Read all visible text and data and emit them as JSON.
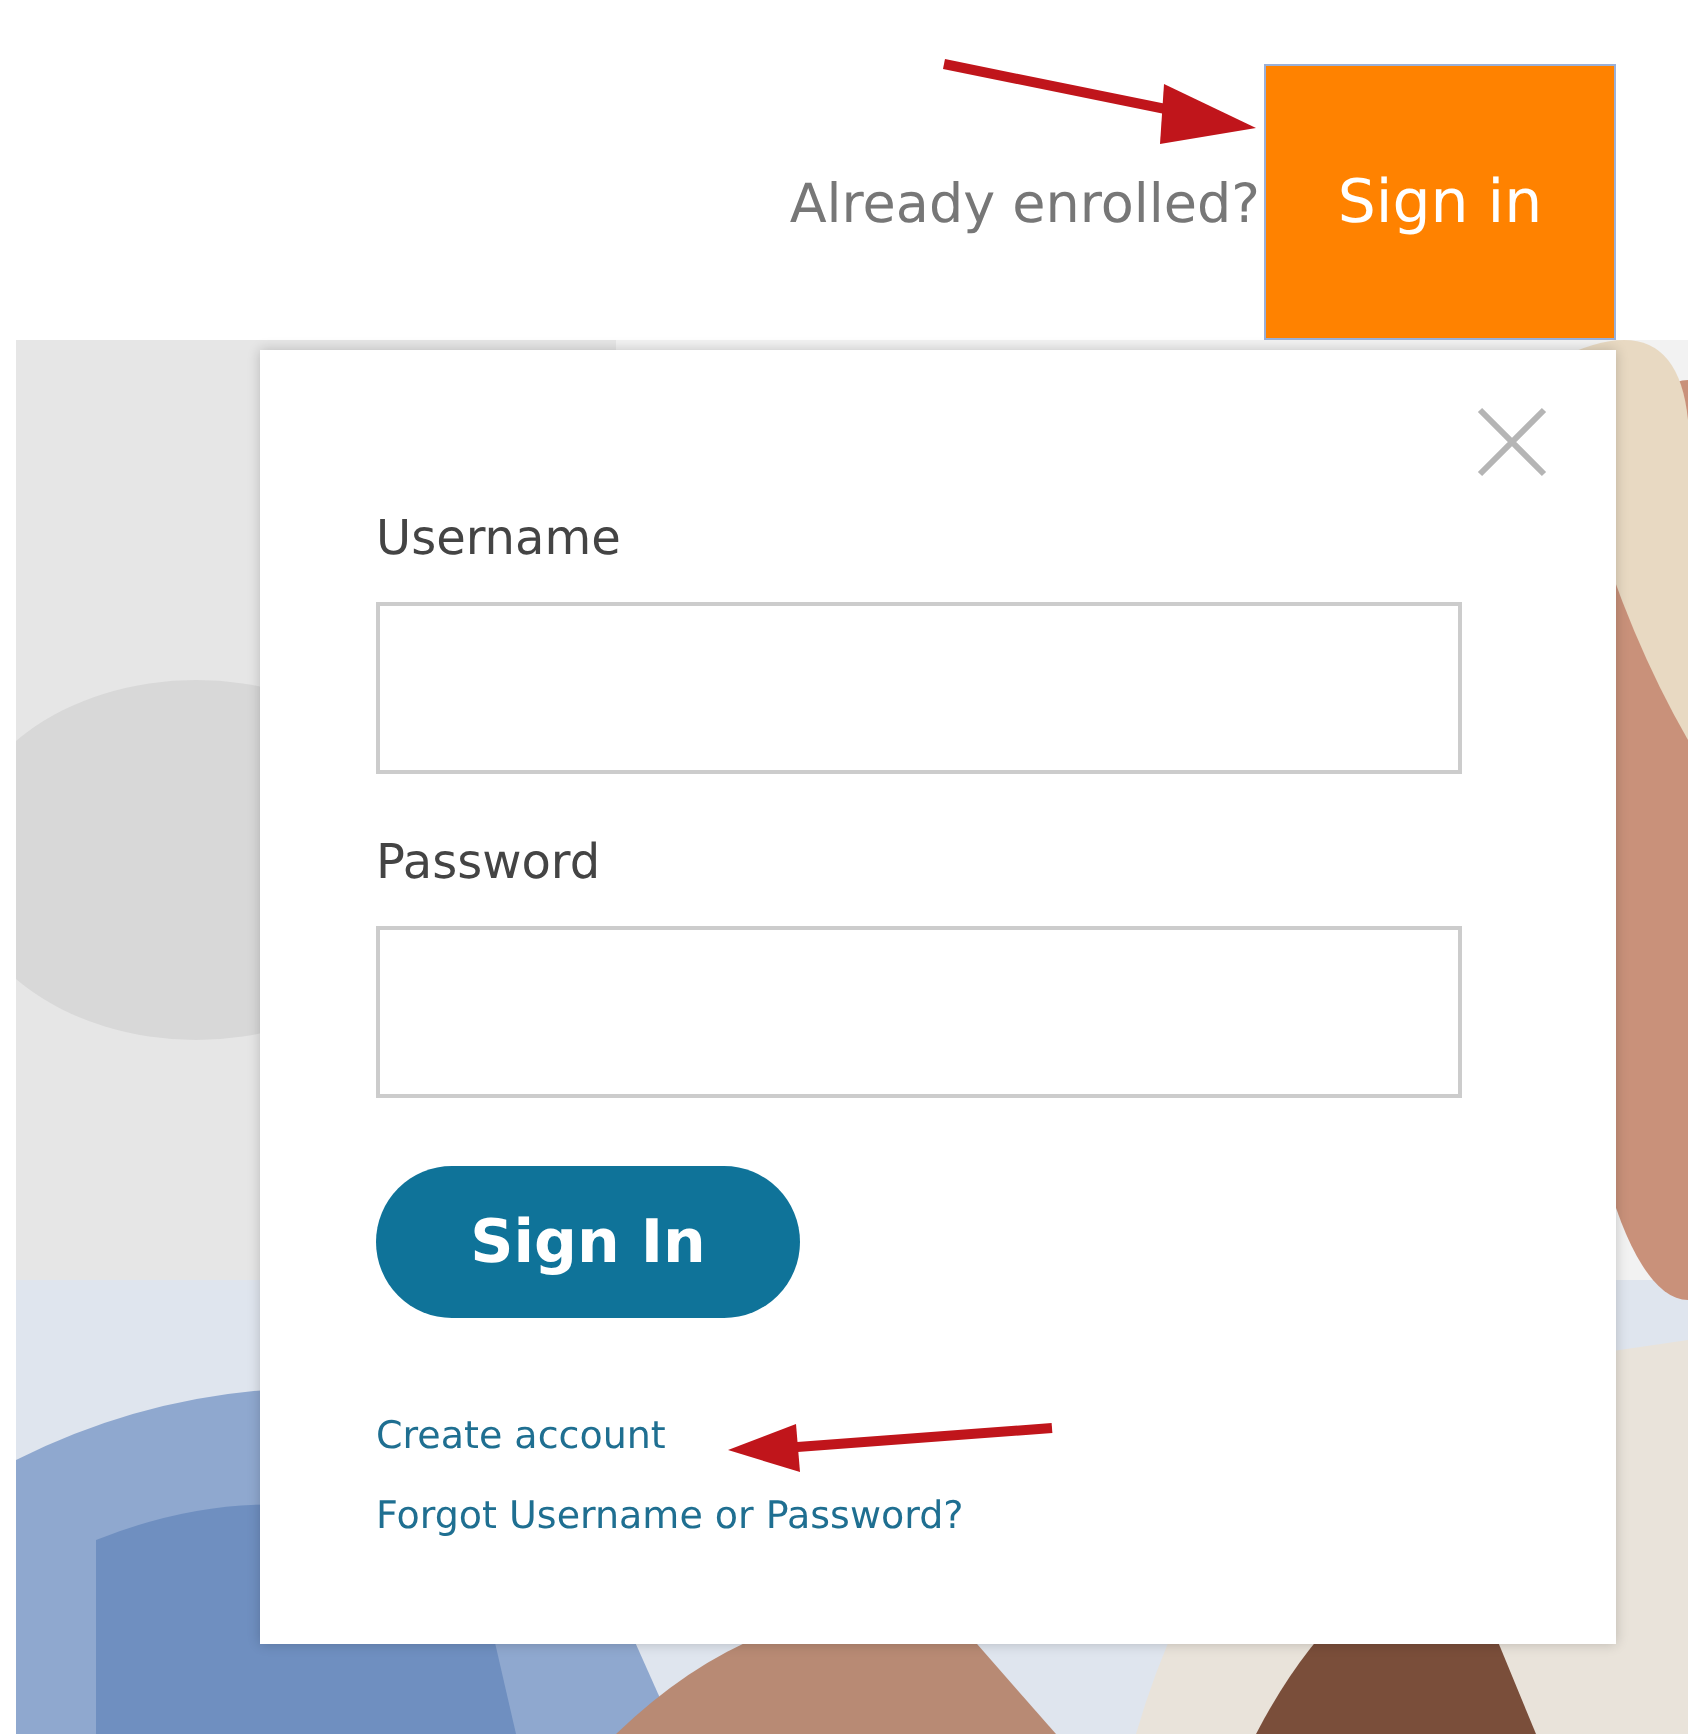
{
  "header": {
    "prompt": "Already enrolled?",
    "sign_in_button": "Sign in"
  },
  "login_popup": {
    "fields": [
      {
        "label": "Username"
      },
      {
        "label": "Password"
      }
    ],
    "submit_button": "Sign In",
    "links": [
      "Create account",
      "Forgot Username or Password?"
    ]
  }
}
